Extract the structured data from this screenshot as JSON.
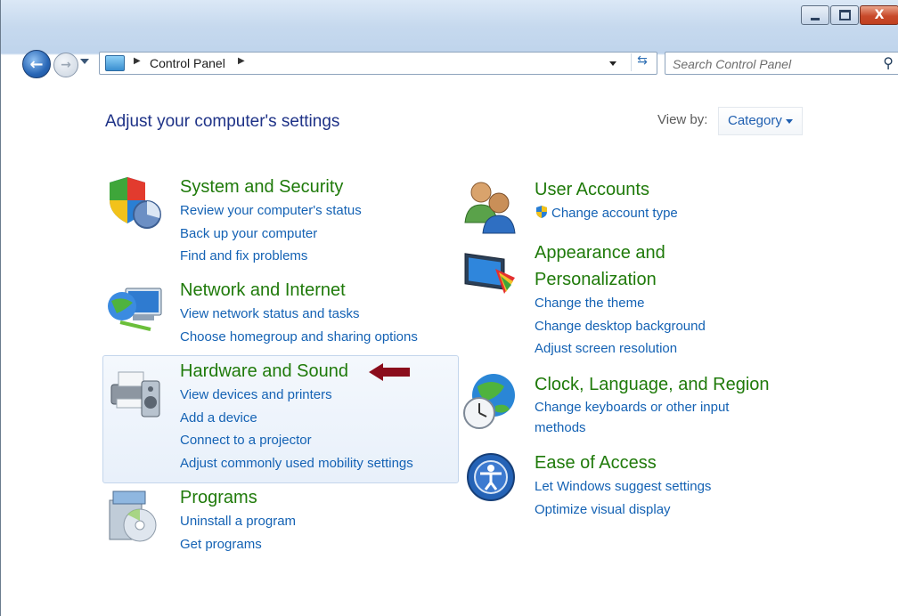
{
  "window": {
    "caption_buttons": [
      "minimize-icon",
      "maximize-icon",
      "close-icon"
    ],
    "close_glyph": "X"
  },
  "address_bar": {
    "path": "Control Panel",
    "separator": "▶"
  },
  "search": {
    "placeholder": "Search Control Panel"
  },
  "header": {
    "title": "Adjust your computer's settings",
    "view_by_label": "View by:",
    "view_by_value": "Category"
  },
  "categories_left": [
    {
      "title": "System and Security",
      "icon": "shield-pie-icon",
      "links": [
        "Review your computer's status",
        "Back up your computer",
        "Find and fix problems"
      ]
    },
    {
      "title": "Network and Internet",
      "icon": "network-globe-icon",
      "links": [
        "View network status and tasks",
        "Choose homegroup and sharing options"
      ]
    },
    {
      "title": "Hardware and Sound",
      "icon": "printer-speaker-icon",
      "links": [
        "View devices and printers",
        "Add a device",
        "Connect to a projector",
        "Adjust commonly used mobility settings"
      ]
    },
    {
      "title": "Programs",
      "icon": "programs-disc-icon",
      "links": [
        "Uninstall a program",
        "Get programs"
      ]
    }
  ],
  "categories_right": [
    {
      "title": "User Accounts",
      "icon": "users-icon",
      "links": [
        "Change account type"
      ]
    },
    {
      "title": "Appearance and Personalization",
      "title_line1": "Appearance and",
      "title_line2": "Personalization",
      "icon": "monitor-palette-icon",
      "links": [
        "Change the theme",
        "Change desktop background",
        "Adjust screen resolution"
      ]
    },
    {
      "title": "Clock, Language, and Region",
      "icon": "globe-clock-icon",
      "links": [
        "Change keyboards or other input methods"
      ]
    },
    {
      "title": "Ease of Access",
      "icon": "ease-of-access-icon",
      "links": [
        "Let Windows suggest settings",
        "Optimize visual display"
      ]
    }
  ],
  "colors": {
    "category_title": "#1f7a0a",
    "link": "#1462b4",
    "heading": "#1e3287",
    "annotation_arrow": "#8b0d1c"
  }
}
